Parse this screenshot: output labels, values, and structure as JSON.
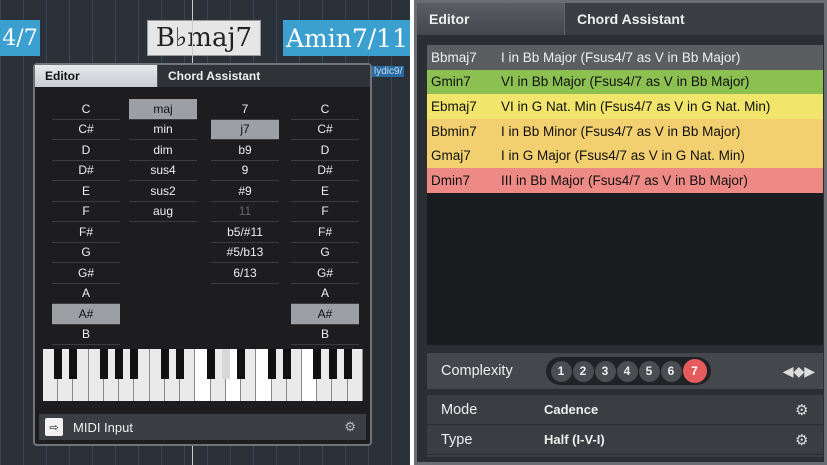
{
  "chips": {
    "left": "4/7",
    "center": "B♭maj7",
    "right": "Amin7/11",
    "lydic": "lydic9/"
  },
  "editor": {
    "tabs": [
      "Editor",
      "Chord Assistant"
    ],
    "roots": [
      "C",
      "C#",
      "D",
      "D#",
      "E",
      "F",
      "F#",
      "G",
      "G#",
      "A",
      "A#",
      "B"
    ],
    "qualities": [
      "maj",
      "min",
      "dim",
      "sus4",
      "sus2",
      "aug"
    ],
    "tensions": [
      "7",
      "j7",
      "b9",
      "9",
      "#9",
      "11",
      "b5/#11",
      "#5/b13",
      "6/13"
    ],
    "bass": [
      "C",
      "C#",
      "D",
      "D#",
      "E",
      "F",
      "F#",
      "G",
      "G#",
      "A",
      "A#",
      "B"
    ],
    "selected": {
      "root": "A#",
      "quality": "maj",
      "tension": "j7",
      "bass": "A#"
    },
    "disabled_tension": "11",
    "midi_label": "MIDI Input"
  },
  "assistant": {
    "tabs": [
      "Editor",
      "Chord Assistant"
    ],
    "suggestions": [
      {
        "chord": "Bbmaj7",
        "desc": "I in Bb Major (Fsus4/7 as V in Bb Major)",
        "color": "#5b5d61",
        "text": "#eee"
      },
      {
        "chord": "Gmin7",
        "desc": "VI in Bb Major (Fsus4/7 as V in Bb Major)",
        "color": "#8cc152",
        "text": "#111"
      },
      {
        "chord": "Ebmaj7",
        "desc": "VI in G Nat. Min (Fsus4/7 as V in G Nat. Min)",
        "color": "#f1e56b",
        "text": "#111"
      },
      {
        "chord": "Bbmin7",
        "desc": "I in Bb Minor (Fsus4/7 as V in Bb Major)",
        "color": "#f2cf6f",
        "text": "#111"
      },
      {
        "chord": "Gmaj7",
        "desc": "I in G Major (Fsus4/7 as V in G Nat. Min)",
        "color": "#f2cf6f",
        "text": "#111"
      },
      {
        "chord": "Dmin7",
        "desc": "III in Bb Major (Fsus4/7 as V in Bb Major)",
        "color": "#ee8a85",
        "text": "#111"
      }
    ],
    "complexity_label": "Complexity",
    "complexity_levels": [
      "1",
      "2",
      "3",
      "4",
      "5",
      "6",
      "7"
    ],
    "complexity_selected": "7",
    "mode_label": "Mode",
    "mode_value": "Cadence",
    "type_label": "Type",
    "type_value": "Half (I-V-I)"
  }
}
